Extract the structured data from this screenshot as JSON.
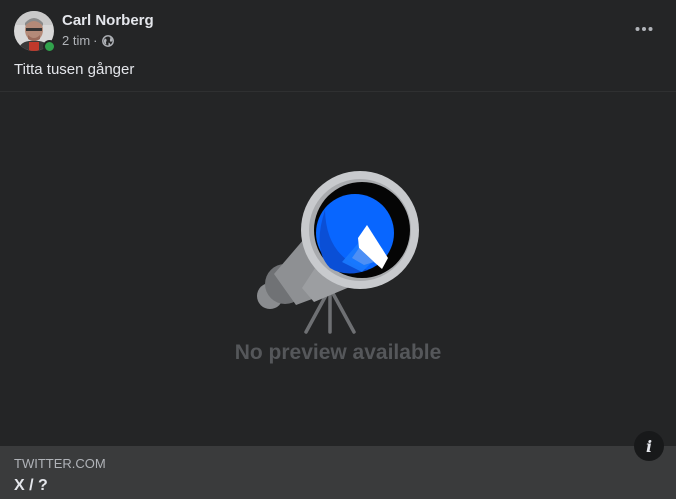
{
  "post": {
    "author": "Carl Norberg",
    "time": "2 tim",
    "separator": "·",
    "audience_icon": "globe-icon",
    "more_icon": "more-horizontal-icon",
    "text": "Titta tusen gånger",
    "online_status_color": "#31a24c"
  },
  "link_preview": {
    "placeholder_icon": "telescope-icon",
    "placeholder_text": "No preview available",
    "info_icon": "info-icon",
    "domain": "TWITTER.COM",
    "title": "X / ?"
  },
  "colors": {
    "background": "#242526",
    "footer_background": "#3a3b3c",
    "accent_blue": "#0866ff"
  }
}
